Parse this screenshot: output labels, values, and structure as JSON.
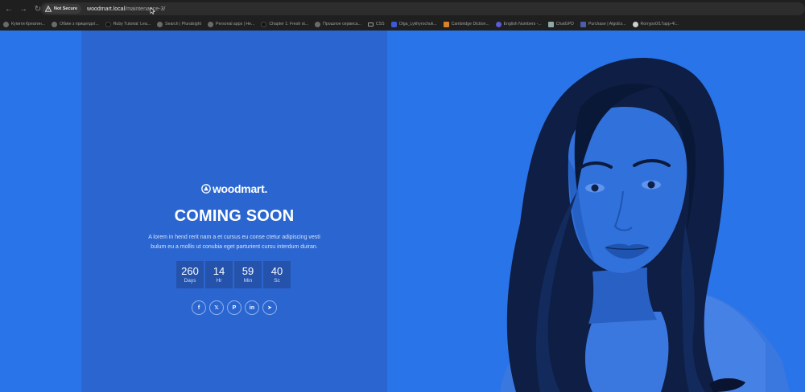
{
  "browser": {
    "security_label": "Not Secure",
    "url_host": "woodmart.local",
    "url_path": "/maintenance-3/",
    "bookmarks": [
      {
        "label": "Купити Креатин...",
        "icon": "globe-icon"
      },
      {
        "label": "Обмін з прицепдої...",
        "icon": "globe-icon"
      },
      {
        "label": "Ruby Tutorial: Lea...",
        "icon": "dark-icon"
      },
      {
        "label": "Search | Pluralsight",
        "icon": "globe-icon"
      },
      {
        "label": "Personal apps | He...",
        "icon": "globe-icon"
      },
      {
        "label": "Chapter 1: Fresh st...",
        "icon": "dark-icon"
      },
      {
        "label": "Прошлое сервиса...",
        "icon": "globe-icon"
      },
      {
        "label": "CSS",
        "icon": "folder-icon"
      },
      {
        "label": "Olga_Lykhyrochuk...",
        "icon": "blue-icon"
      },
      {
        "label": "Cambridge Diction...",
        "icon": "orange-icon"
      },
      {
        "label": "English Numbers -...",
        "icon": "purple-icon"
      },
      {
        "label": "ChatGPD",
        "icon": "teal-icon"
      },
      {
        "label": "Purchase | AlgoEx...",
        "icon": "grid-icon"
      },
      {
        "label": "Rorrypo0/17app-4l...",
        "icon": "github-icon"
      }
    ]
  },
  "page": {
    "logo_text": "woodmart.",
    "title": "COMING SOON",
    "description": "A lorem in hend rerit nam a et cursus eu conse ctetur adipiscing vesti bulum eu a mollis ut conubia eget parturient cursu interdum duiran.",
    "countdown": [
      {
        "value": "260",
        "label": "Days"
      },
      {
        "value": "14",
        "label": "Hr"
      },
      {
        "value": "59",
        "label": "Min"
      },
      {
        "value": "40",
        "label": "Sc"
      }
    ],
    "socials": [
      {
        "name": "facebook",
        "glyph": "f"
      },
      {
        "name": "x",
        "glyph": "𝕏"
      },
      {
        "name": "pinterest",
        "glyph": "P"
      },
      {
        "name": "linkedin",
        "glyph": "in"
      },
      {
        "name": "telegram",
        "glyph": "➤"
      }
    ]
  },
  "colors": {
    "page_background": "#2a74ea",
    "panel_background": "#2b66d0",
    "countdown_box": "#2553ac",
    "browser_chrome": "#1f1f1f"
  }
}
